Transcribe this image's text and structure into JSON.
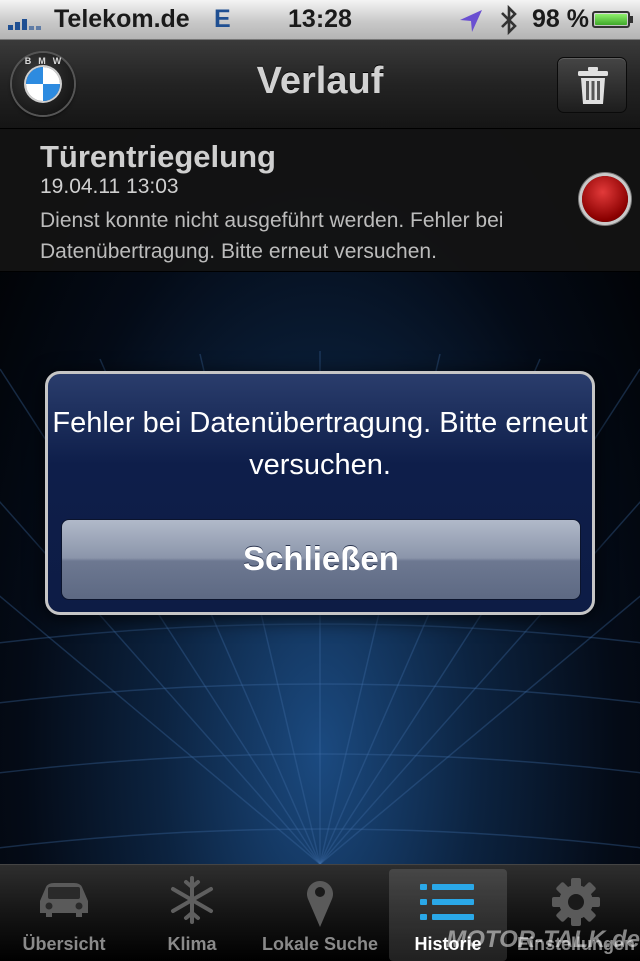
{
  "status_bar": {
    "carrier": "Telekom.de",
    "network": "E",
    "time": "13:28",
    "battery_percent": "98 %",
    "battery_level": 0.98,
    "icons": [
      "signal-icon",
      "location-arrow-icon",
      "bluetooth-icon",
      "battery-icon"
    ]
  },
  "nav": {
    "title": "Verlauf",
    "logo_text": "BMW",
    "trash_icon": "trash-icon"
  },
  "history": {
    "items": [
      {
        "title": "Türentriegelung",
        "date": "19.04.11 13:03",
        "message": "Dienst konnte nicht ausgeführt werden. Fehler bei Datenübertragung. Bitte erneut versuchen.",
        "status_color": "#c00000"
      }
    ]
  },
  "alert": {
    "message": "Fehler bei Datenübertragung. Bitte erneut versuchen.",
    "button_label": "Schließen"
  },
  "tabs": [
    {
      "label": "Übersicht",
      "icon": "car-icon",
      "active": false
    },
    {
      "label": "Klima",
      "icon": "snowflake-icon",
      "active": false
    },
    {
      "label": "Lokale Suche",
      "icon": "map-pin-icon",
      "active": false
    },
    {
      "label": "Historie",
      "icon": "list-icon",
      "active": true
    },
    {
      "label": "Einstellungen",
      "icon": "gear-icon",
      "active": false
    }
  ],
  "watermark": "MOTOR-TALK.de"
}
